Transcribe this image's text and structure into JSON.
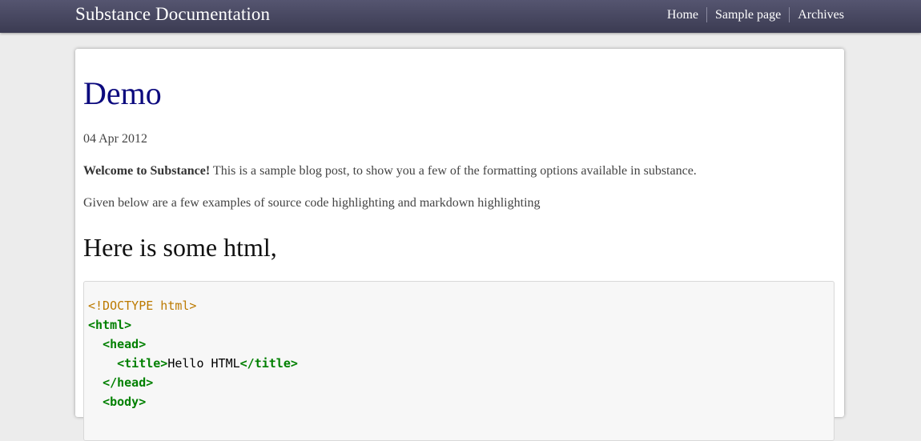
{
  "header": {
    "brand": "Substance Documentation",
    "nav": [
      {
        "label": "Home"
      },
      {
        "label": "Sample page"
      },
      {
        "label": "Archives"
      }
    ]
  },
  "post": {
    "title": "Demo",
    "date": "04 Apr 2012",
    "intro_bold": "Welcome to Substance!",
    "intro_rest": " This is a sample blog post, to show you a few of the formatting options available in substance.",
    "paragraph2": "Given below are a few examples of source code highlighting and markdown highlighting",
    "section_heading": "Here is some html,",
    "code": {
      "line1": "<!DOCTYPE html>",
      "line2": "<html>",
      "line3_indent": "  ",
      "line3": "<head>",
      "line4_indent": "    ",
      "line4_open": "<title>",
      "line4_text": "Hello HTML",
      "line4_close": "</title>",
      "line5_indent": "  ",
      "line5": "</head>",
      "line6_indent": "  ",
      "line6": "<body>"
    }
  },
  "colors": {
    "title": "#0c0a7e",
    "topbar": "#3b3b52",
    "doctype": "#bc7a00",
    "tag": "#008000"
  }
}
